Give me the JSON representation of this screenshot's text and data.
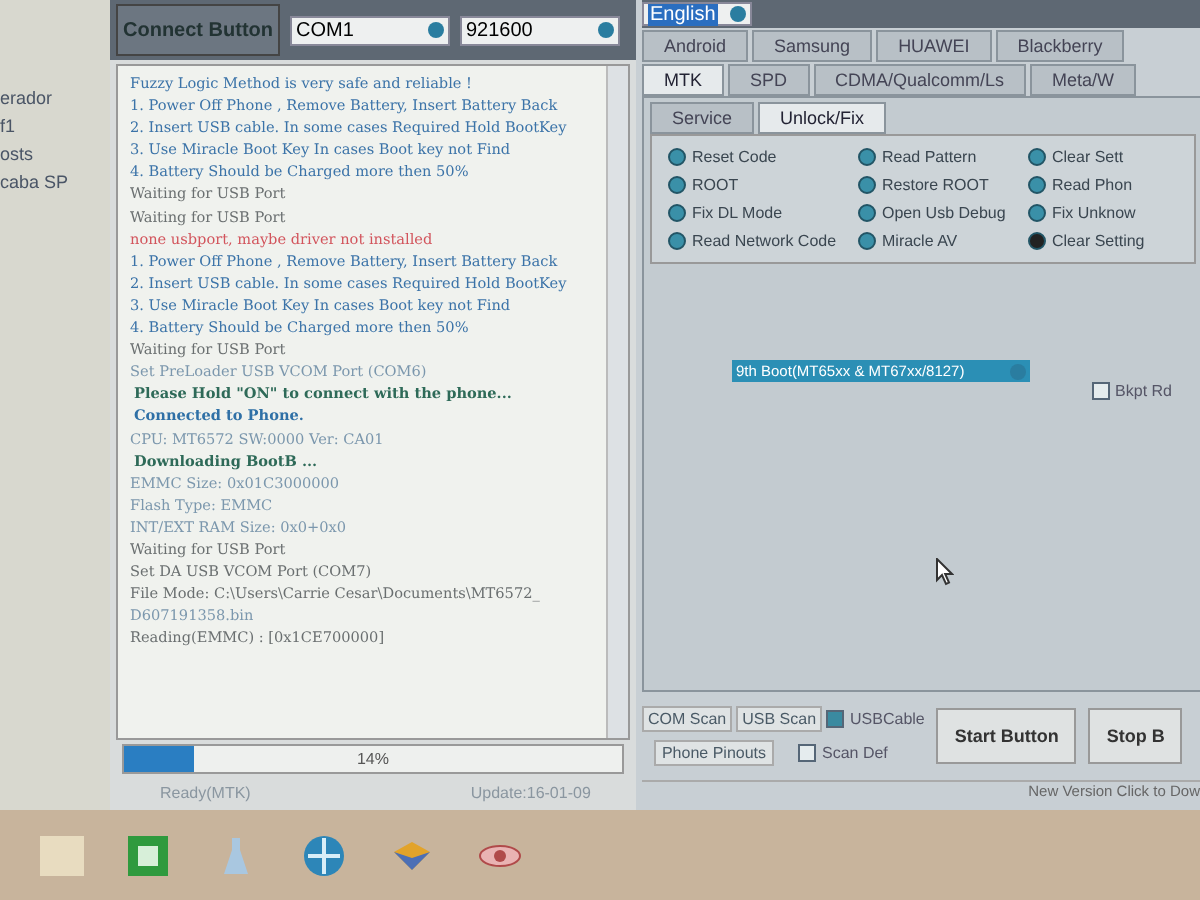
{
  "desktop_items": [
    "erador",
    "f1",
    "osts",
    "caba SP"
  ],
  "toolbar": {
    "connect_button": "Connect Button",
    "port": "COM1",
    "baud": "921600",
    "language": "English"
  },
  "log": [
    {
      "kind": "info",
      "text": "Fuzzy Logic Method is very safe and reliable !"
    },
    {
      "kind": "info",
      "text": "1. Power Off Phone , Remove Battery, Insert Battery Back"
    },
    {
      "kind": "info",
      "text": "2. Insert USB cable. In some cases Required Hold BootKey"
    },
    {
      "kind": "info",
      "text": "3. Use Miracle Boot Key In cases Boot key not Find"
    },
    {
      "kind": "info",
      "text": "4. Battery Should be Charged more then 50%"
    },
    {
      "kind": "plain",
      "text": "Waiting for USB Port"
    },
    {
      "kind": "plain",
      "text": "Waiting for USB Port"
    },
    {
      "kind": "error",
      "text": "none usbport, maybe driver not installed"
    },
    {
      "kind": "info",
      "text": "1. Power Off Phone , Remove Battery, Insert Battery Back"
    },
    {
      "kind": "info",
      "text": "2. Insert USB cable. In some cases Required Hold BootKey"
    },
    {
      "kind": "info",
      "text": "3. Use Miracle Boot Key In cases Boot key not Find"
    },
    {
      "kind": "info",
      "text": "4. Battery Should be Charged more then 50%"
    },
    {
      "kind": "plain",
      "text": "Waiting for USB Port"
    },
    {
      "kind": "muted",
      "text": "Set PreLoader USB VCOM Port (COM6)"
    },
    {
      "kind": "bold",
      "text": "Please Hold \"ON\" to connect with the phone..."
    },
    {
      "kind": "strong",
      "text": "Connected to Phone."
    },
    {
      "kind": "muted",
      "text": "CPU: MT6572 SW:0000 Ver: CA01"
    },
    {
      "kind": "bold",
      "text": "Downloading BootB ..."
    },
    {
      "kind": "muted",
      "text": "EMMC Size: 0x01C3000000"
    },
    {
      "kind": "muted",
      "text": "Flash Type: EMMC"
    },
    {
      "kind": "muted",
      "text": "INT/EXT RAM  Size: 0x0+0x0"
    },
    {
      "kind": "plain",
      "text": "Waiting for USB Port"
    },
    {
      "kind": "plain",
      "text": "Set DA USB VCOM Port (COM7)"
    },
    {
      "kind": "plain",
      "text": "File Mode: C:\\Users\\Carrie Cesar\\Documents\\MT6572_"
    },
    {
      "kind": "muted",
      "text": "D607191358.bin"
    },
    {
      "kind": "plain",
      "text": "Reading(EMMC) : [0x1CE700000]"
    }
  ],
  "progress": {
    "level": 0.14,
    "label": "14%"
  },
  "status_bar": [
    "Ready(MTK)",
    "Update:16-01-09"
  ],
  "brand_tabs": [
    {
      "label": "Android",
      "selected": false
    },
    {
      "label": "Samsung",
      "selected": false
    },
    {
      "label": "HUAWEI",
      "selected": false
    },
    {
      "label": "Blackberry",
      "selected": false
    }
  ],
  "chip_tabs": [
    {
      "label": "MTK",
      "selected": true
    },
    {
      "label": "SPD",
      "selected": false
    },
    {
      "label": "CDMA/Qualcomm/Ls",
      "selected": false
    },
    {
      "label": "Meta/W",
      "selected": false
    }
  ],
  "sub_tabs": [
    {
      "label": "Service",
      "selected": false
    },
    {
      "label": "Unlock/Fix",
      "selected": true
    }
  ],
  "options": [
    [
      {
        "label": "Reset Code",
        "selected": false
      },
      {
        "label": "ROOT",
        "selected": false
      },
      {
        "label": "Fix DL Mode",
        "selected": false
      },
      {
        "label": "Read Network Code",
        "selected": false
      }
    ],
    [
      {
        "label": "Read Pattern",
        "selected": false
      },
      {
        "label": "Restore ROOT",
        "selected": false
      },
      {
        "label": "Open Usb Debug",
        "selected": false
      },
      {
        "label": "Miracle AV",
        "selected": false
      }
    ],
    [
      {
        "label": "Clear Sett",
        "selected": false
      },
      {
        "label": "Read Phon",
        "selected": false
      },
      {
        "label": "Fix Unknow",
        "selected": false
      },
      {
        "label": "Clear Setting",
        "selected": true
      }
    ]
  ],
  "boot_select": "9th Boot(MT65xx & MT67xx/8127)",
  "bkpt": {
    "label": "Bkpt Rd",
    "checked": false
  },
  "scan_buttons": [
    "COM Scan",
    "USB Scan"
  ],
  "usb_cable": {
    "label": "USBCable",
    "checked": true
  },
  "pinouts_button": "Phone Pinouts",
  "scan_def": {
    "label": "Scan Def",
    "checked": false
  },
  "start_button": "Start Button",
  "stop_button": "Stop B",
  "new_version": "New Version Click to Dow"
}
